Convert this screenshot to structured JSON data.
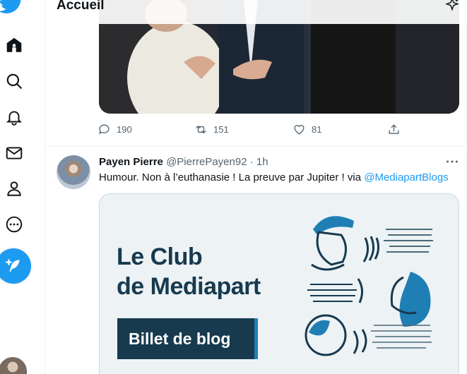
{
  "header": {
    "title": "Accueil"
  },
  "sidebar": {
    "items": [
      {
        "name": "home"
      },
      {
        "name": "explore"
      },
      {
        "name": "notifications"
      },
      {
        "name": "messages"
      },
      {
        "name": "profile"
      },
      {
        "name": "more"
      }
    ]
  },
  "tweet1": {
    "replies": "190",
    "retweets": "151",
    "likes": "81"
  },
  "tweet2": {
    "name": "Payen Pierre",
    "meta": "@PierrePayen92 · 1h",
    "text": "Humour. Non à l’euthanasie !  La preuve par Jupiter ! via ",
    "link": "@MediapartBlogs",
    "card": {
      "line1": "Le Club",
      "line2": "de Mediapart",
      "button": "Billet de blog"
    }
  },
  "colors": {
    "accent": "#1d9bf0",
    "card_text": "#173a4e",
    "card_bg": "#edf2f5"
  }
}
